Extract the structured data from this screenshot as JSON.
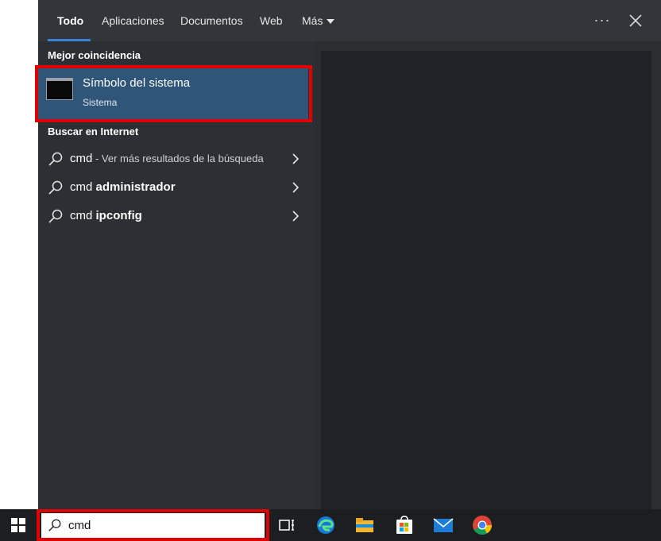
{
  "tabs": [
    {
      "label": "Todo",
      "active": true
    },
    {
      "label": "Aplicaciones"
    },
    {
      "label": "Documentos"
    },
    {
      "label": "Web"
    },
    {
      "label": "Más"
    }
  ],
  "toolbar": {
    "more_label": "···"
  },
  "best_match": {
    "section_label": "Mejor coincidencia",
    "title": "Símbolo del sistema",
    "subtitle": "Sistema"
  },
  "web_search": {
    "section_label": "Buscar en Internet",
    "items": [
      {
        "query": "cmd",
        "suffix": " - Ver más resultados de la búsqueda",
        "bold": ""
      },
      {
        "query": "cmd ",
        "suffix": "",
        "bold": "administrador"
      },
      {
        "query": "cmd ",
        "suffix": "",
        "bold": "ipconfig"
      }
    ]
  },
  "search": {
    "value": "cmd"
  },
  "colors": {
    "accent": "#3b82d6",
    "highlight": "#e00000",
    "selected": "#2f5579"
  },
  "taskbar_icons": [
    "windows-start-icon",
    "task-view-icon",
    "edge-icon",
    "file-explorer-icon",
    "store-icon",
    "mail-icon",
    "chrome-icon"
  ]
}
